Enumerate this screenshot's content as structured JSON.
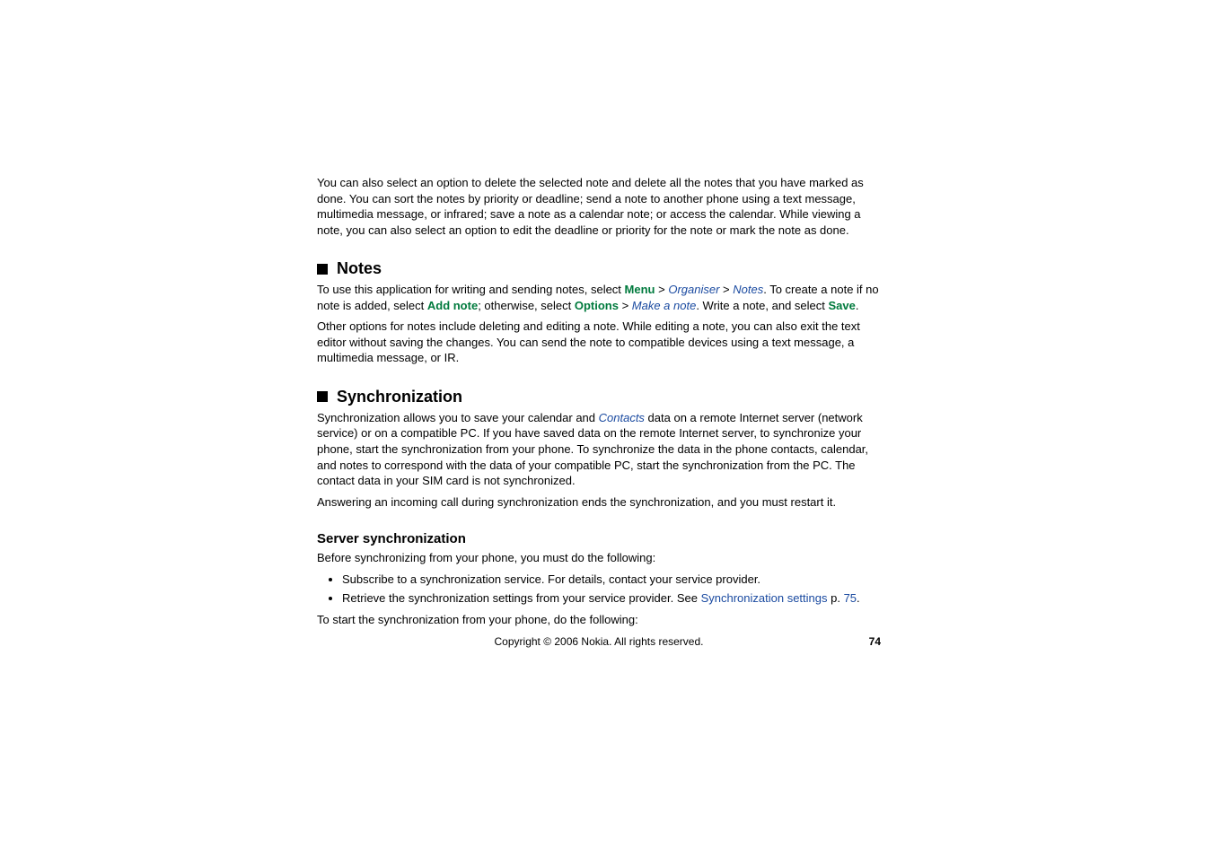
{
  "intro_para": "You can also select an option to delete the selected note and delete all the notes that you have marked as done. You can sort the notes by priority or deadline; send a note to another phone using a text message, multimedia message, or infrared; save a note as a calendar note; or access the calendar. While viewing a note, you can also select an option to edit the deadline or priority for the note or mark the note as done.",
  "notes": {
    "heading": "Notes",
    "p1_a": "To use this application for writing and sending notes, select ",
    "menu": "Menu",
    "gt": " > ",
    "organiser": "Organiser",
    "notes_link": "Notes",
    "p1_b": ". To create a note if no note is added, select ",
    "add_note": "Add note",
    "p1_c": "; otherwise, select ",
    "options": "Options",
    "make_a_note": "Make a note",
    "p1_d": ". Write a note, and select ",
    "save": "Save",
    "p1_e": ".",
    "p2": "Other options for notes include deleting and editing a note. While editing a note, you can also exit the text editor without saving the changes. You can send the note to compatible devices using a text message, a multimedia message, or IR."
  },
  "sync": {
    "heading": "Synchronization",
    "p1_a": "Synchronization allows you to save your calendar and ",
    "contacts": "Contacts",
    "p1_b": " data on a remote Internet server (network service) or on a compatible PC. If you have saved data on the remote Internet server, to synchronize your phone, start the synchronization from your phone. To synchronize the data in the phone contacts, calendar, and notes to correspond with the data of your compatible PC, start the synchronization from the PC. The contact data in your SIM card is not synchronized.",
    "p2": "Answering an incoming call during synchronization ends the synchronization, and you must restart it."
  },
  "server_sync": {
    "heading": "Server synchronization",
    "p1": "Before synchronizing from your phone, you must do the following:",
    "bullet1": "Subscribe to a synchronization service. For details, contact your service provider.",
    "bullet2_a": "Retrieve the synchronization settings from your service provider. See ",
    "sync_settings_link": "Synchronization settings",
    "bullet2_b": " p. ",
    "page_link": "75",
    "bullet2_c": ".",
    "p2": "To start the synchronization from your phone, do the following:"
  },
  "footer": {
    "copyright": "Copyright © 2006 Nokia. All rights reserved.",
    "page_no": "74"
  }
}
